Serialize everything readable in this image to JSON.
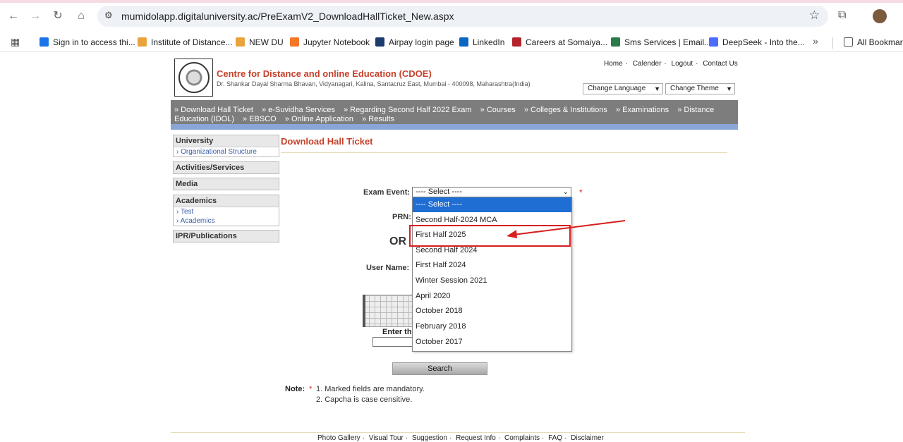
{
  "browser": {
    "url": "mumidolapp.digitaluniversity.ac/PreExamV2_DownloadHallTicket_New.aspx",
    "bookmarks": [
      {
        "label": "Sign in to access thi...",
        "color": "#1a73e8"
      },
      {
        "label": "Institute of Distance...",
        "color": "#e8a33d"
      },
      {
        "label": "NEW DU",
        "color": "#e8a33d"
      },
      {
        "label": "Jupyter Notebook",
        "color": "#f37726"
      },
      {
        "label": "Airpay login page",
        "color": "#1d3c6e"
      },
      {
        "label": "LinkedIn",
        "color": "#0a66c2"
      },
      {
        "label": "Careers at Somaiya...",
        "color": "#b4232a"
      },
      {
        "label": "Sms Services | Email...",
        "color": "#2a7b4a"
      },
      {
        "label": "DeepSeek - Into the...",
        "color": "#4d6bfe"
      }
    ],
    "all_bookmarks": "All Bookmarks"
  },
  "header": {
    "title": "Centre for Distance and online Education (CDOE)",
    "address": "Dr. Shankar Dayal Sharma Bhavan, Vidyanagari, Kalina, Santacruz East, Mumbai - 400098, Maharashtra(India)",
    "links": [
      "Home",
      "Calender",
      "Logout",
      "Contact Us"
    ],
    "change_language": "Change Language",
    "change_theme": "Change Theme"
  },
  "menu": [
    "» Download Hall Ticket",
    "» e-Suvidha Services",
    "» Regarding Second Half 2022 Exam",
    "» Courses",
    "» Colleges & Institutions",
    "» Examinations",
    "» Distance Education (IDOL)",
    "» EBSCO",
    "» Online Application",
    "» Results"
  ],
  "sidebar": {
    "university": {
      "header": "University",
      "items": [
        "Organizational Structure"
      ]
    },
    "activities": {
      "header": "Activities/Services"
    },
    "media": {
      "header": "Media"
    },
    "academics": {
      "header": "Academics",
      "items": [
        "Test",
        "Academics"
      ]
    },
    "ipr": {
      "header": "IPR/Publications"
    }
  },
  "content": {
    "title": "Download Hall Ticket",
    "exam_event_label": "Exam Event:",
    "exam_event_value": "---- Select ----",
    "prn_label": "PRN:",
    "or_label": "OR",
    "username_label": "User Name:",
    "captcha_label": "Enter th",
    "search_button": "Search",
    "note_label": "Note:",
    "notes": [
      "1. Marked fields are mandatory.",
      "2. Capcha is case censitive."
    ]
  },
  "dropdown": {
    "options": [
      "---- Select ----",
      "Second Half-2024 MCA",
      "First Half 2025",
      "Second Half 2024",
      "First Half 2024",
      "Winter Session 2021",
      "April 2020",
      "October 2018",
      "February 2018",
      "October 2017"
    ],
    "selected_index": 0,
    "highlighted_index": 2
  },
  "footer": {
    "links": [
      "Photo Gallery",
      "Visual Tour",
      "Suggestion",
      "Request Info",
      "Complaints",
      "FAQ",
      "Disclaimer"
    ]
  },
  "colors": {
    "accent": "#c5412b",
    "menu_bg": "#7d7d7d",
    "highlight": "#d61f1f",
    "selected_option": "#1f6ed4"
  }
}
